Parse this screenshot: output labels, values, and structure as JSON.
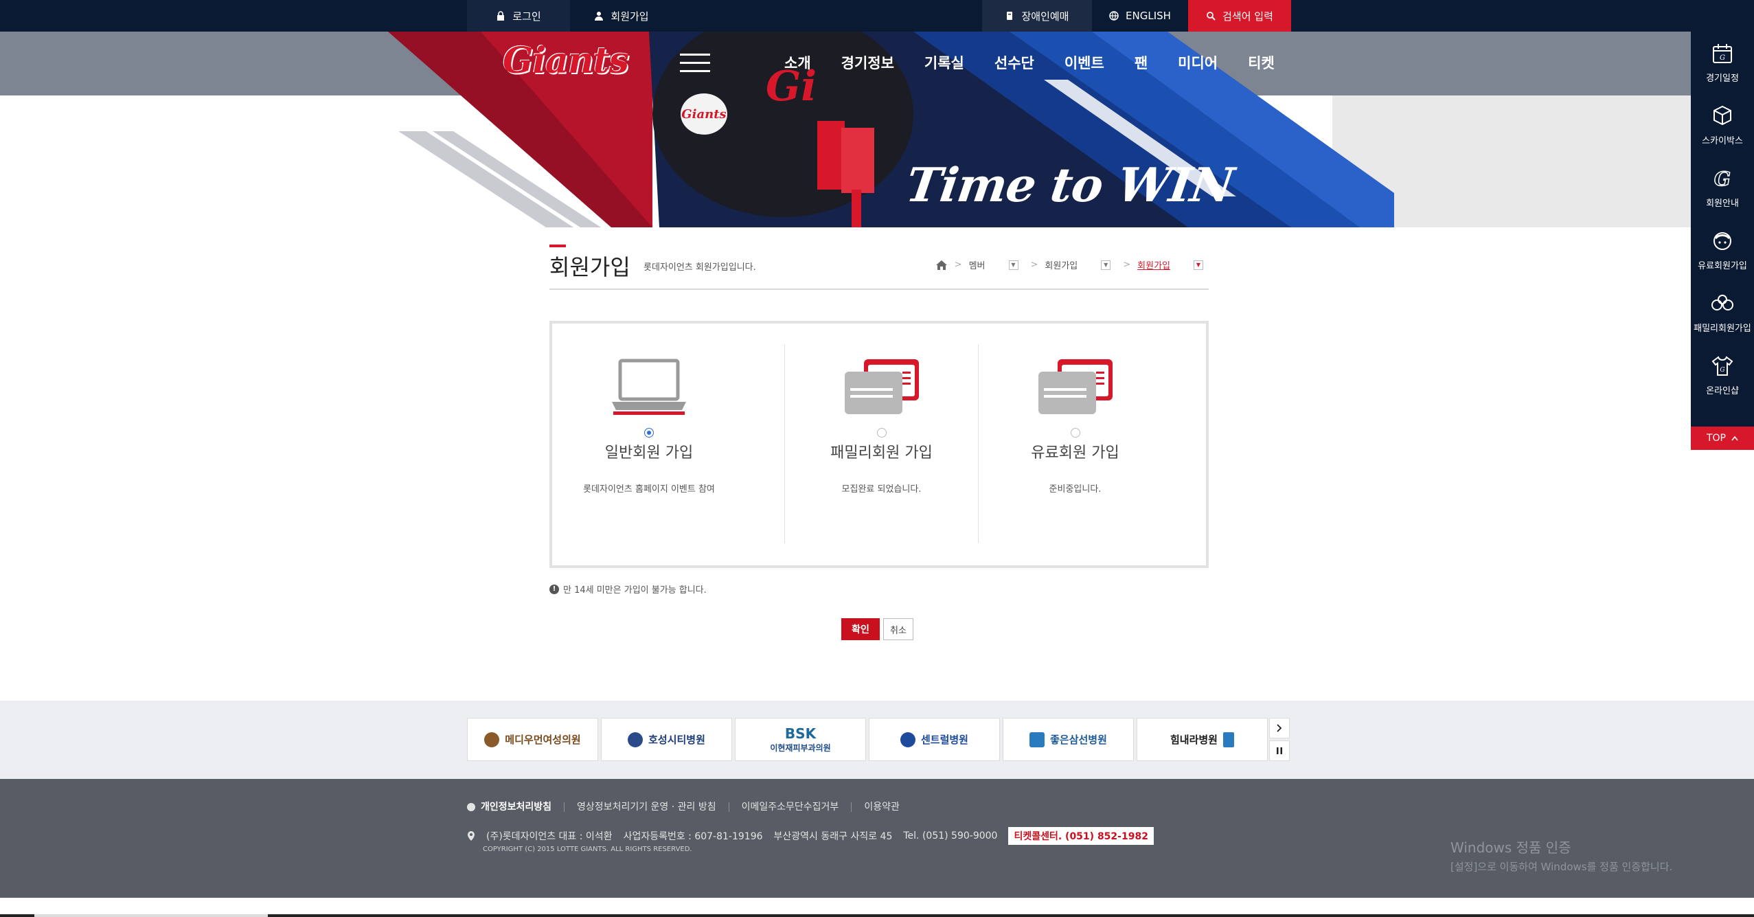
{
  "topbar": {
    "login": "로그인",
    "join": "회원가입",
    "accessibility": "장애인예매",
    "english": "ENGLISH",
    "search": "검색어 입력"
  },
  "header": {
    "logo": "Giants",
    "menu": [
      "소개",
      "경기정보",
      "기록실",
      "선수단",
      "이벤트",
      "팬",
      "미디어",
      "티켓"
    ],
    "slogan": "Time to WIN"
  },
  "quickbar": {
    "items": [
      {
        "label": "경기일정",
        "icon": "calendar-icon"
      },
      {
        "label": "스카이박스",
        "icon": "box-icon"
      },
      {
        "label": "회원안내",
        "icon": "giants-g-icon"
      },
      {
        "label": "유료회원가입",
        "icon": "fan-icon"
      },
      {
        "label": "패밀리회원가입",
        "icon": "family-icon"
      },
      {
        "label": "온라인샵",
        "icon": "shirt-icon"
      }
    ],
    "top": "TOP"
  },
  "page": {
    "title": "회원가입",
    "subtitle": "롯데자이언츠 회원가입입니다.",
    "breadcrumb": [
      "멤버",
      "회원가입",
      "회원가입"
    ]
  },
  "membership": {
    "options": [
      {
        "label": "일반회원 가입",
        "desc": "롯데자이언츠 홈페이지 이벤트 참여",
        "selected": true
      },
      {
        "label": "패밀리회원 가입",
        "desc": "모집완료 되었습니다.",
        "selected": false
      },
      {
        "label": "유료회원 가입",
        "desc": "준비중입니다.",
        "selected": false
      }
    ],
    "notice": "만 14세 미만은 가입이 불가능 합니다.",
    "confirm": "확인",
    "cancel": "취소"
  },
  "sponsors": [
    {
      "name": "메디우먼여성의원",
      "color": "#7a4a1c"
    },
    {
      "name": "호성시티병원",
      "color": "#1d3d7a"
    },
    {
      "name": "이현재피부과의원",
      "color": "#1d4a8a"
    },
    {
      "name": "센트럴병원",
      "color": "#1d4a9a"
    },
    {
      "name": "좋은삼선병원",
      "color": "#1d5a9a"
    },
    {
      "name": "힘내라병원",
      "color": "#1a1a1a"
    }
  ],
  "sponsor_small": {
    "bsk": "BSK"
  },
  "footer": {
    "links": [
      "개인정보처리방침",
      "영상정보처리기기 운영 · 관리 방침",
      "이메일주소무단수집거부",
      "이용약관"
    ],
    "company": "(주)롯데자이언츠 대표 : 이석환",
    "bizno": "사업자등록번호 : 607-81-19196",
    "address": "부산광역시 동래구 사직로 45",
    "tel": "Tel. (051) 590-9000",
    "ticket_center": "티켓콜센터. (051) 852-1982",
    "copyright": "COPYRIGHT (C) 2015 LOTTE GIANTS. ALL RIGHTS RESERVED."
  },
  "watermark": {
    "line1": "Windows 정품 인증",
    "line2": "[설정]으로 이동하여 Windows를 정품 인증합니다."
  },
  "colors": {
    "navy": "#0b1a33",
    "red": "#d7182a",
    "blue": "#1b4fb0",
    "footer": "#585d65"
  }
}
